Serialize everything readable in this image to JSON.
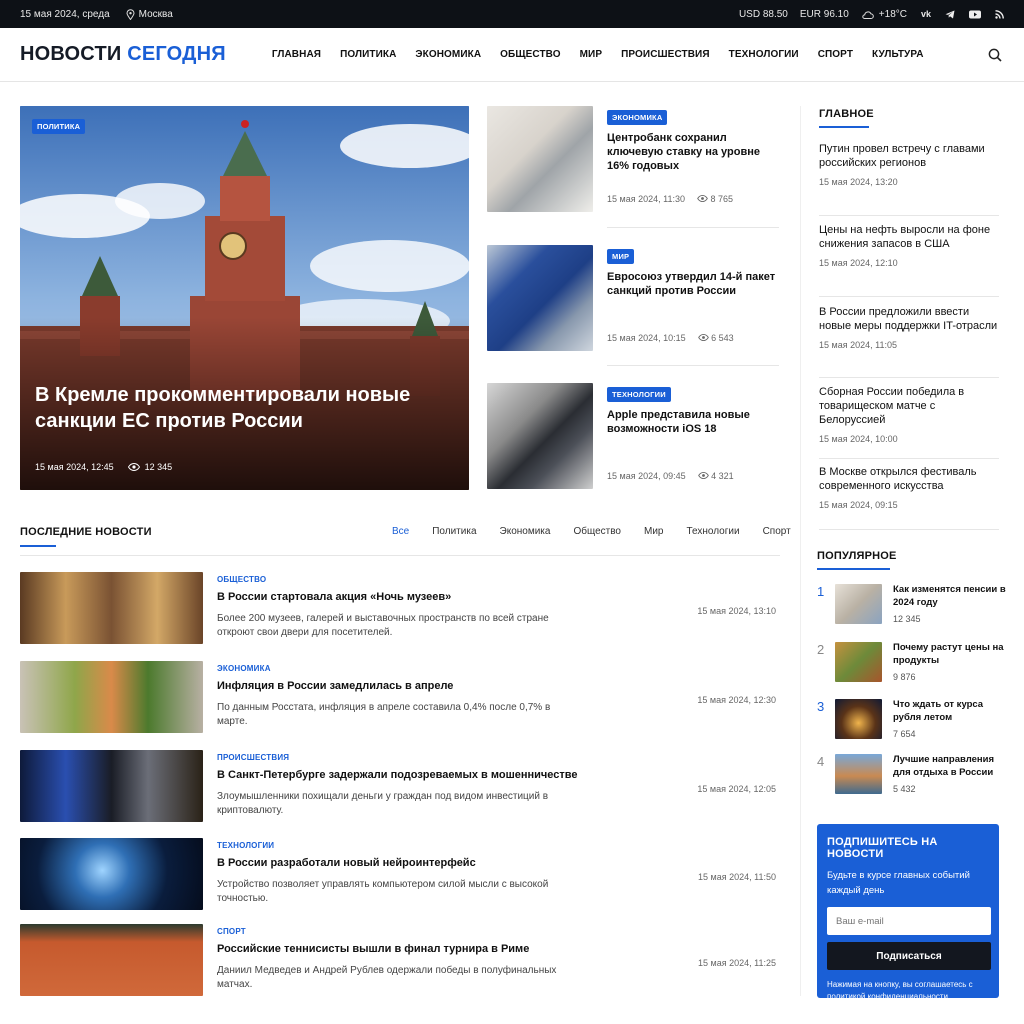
{
  "topbar": {
    "date": "15 мая 2024, среда",
    "city": "Москва",
    "usd": "USD 88.50",
    "eur": "EUR 96.10",
    "weather": "+18°C",
    "social": [
      "vk-icon",
      "telegram-icon",
      "youtube-icon",
      "rss-icon"
    ]
  },
  "header": {
    "logo_a": "НОВОСТИ",
    "logo_b": "СЕГОДНЯ",
    "nav": [
      "ГЛАВНАЯ",
      "ПОЛИТИКА",
      "ЭКОНОМИКА",
      "ОБЩЕСТВО",
      "МИР",
      "ПРОИСШЕСТВИЯ",
      "ТЕХНОЛОГИИ",
      "СПОРТ",
      "КУЛЬТУРА"
    ]
  },
  "hero": {
    "category": "ПОЛИТИКА",
    "title": "В Кремле прокомментировали новые санкции ЕС против России",
    "date": "15 мая 2024, 12:45",
    "views": "12 345"
  },
  "side_articles": [
    {
      "category": "ЭКОНОМИКА",
      "title": "Центробанк сохранил ключевую ставку на уровне 16% годовых",
      "date": "15 мая 2024, 11:30",
      "views": "8 765"
    },
    {
      "category": "МИР",
      "title": "Евросоюз утвердил 14-й пакет санкций против России",
      "date": "15 мая 2024, 10:15",
      "views": "6 543"
    },
    {
      "category": "ТЕХНОЛОГИИ",
      "title": "Apple представила новые возможности iOS 18",
      "date": "15 мая 2024, 09:45",
      "views": "4 321"
    }
  ],
  "main_block": {
    "title": "ГЛАВНОЕ",
    "items": [
      {
        "title": "Путин провел встречу с главами российских регионов",
        "date": "15 мая 2024, 13:20"
      },
      {
        "title": "Цены на нефть выросли на фоне снижения запасов в США",
        "date": "15 мая 2024, 12:10"
      },
      {
        "title": "В России предложили ввести новые меры поддержки IT-отрасли",
        "date": "15 мая 2024, 11:05"
      },
      {
        "title": "Сборная России победила в товарищеском матче с Белоруссией",
        "date": "15 мая 2024, 10:00"
      },
      {
        "title": "В Москве открылся фестиваль современного искусства",
        "date": "15 мая 2024, 09:15"
      }
    ]
  },
  "latest": {
    "title": "ПОСЛЕДНИЕ НОВОСТИ",
    "tabs": [
      "Все",
      "Политика",
      "Экономика",
      "Общество",
      "Мир",
      "Технологии",
      "Спорт"
    ],
    "items": [
      {
        "category": "ОБЩЕСТВО",
        "title": "В России стартовала акция «Ночь музеев»",
        "desc": "Более 200 музеев, галерей и выставочных пространств по всей стране откроют свои двери для посетителей.",
        "date": "15 мая 2024, 13:10"
      },
      {
        "category": "ЭКОНОМИКА",
        "title": "Инфляция в России замедлилась в апреле",
        "desc": "По данным Росстата, инфляция в апреле составила 0,4% после 0,7% в марте.",
        "date": "15 мая 2024, 12:30"
      },
      {
        "category": "ПРОИСШЕСТВИЯ",
        "title": "В Санкт-Петербурге задержали подозреваемых в мошенничестве",
        "desc": "Злоумышленники похищали деньги у граждан под видом инвестиций в криптовалюту.",
        "date": "15 мая 2024, 12:05"
      },
      {
        "category": "ТЕХНОЛОГИИ",
        "title": "В России разработали новый нейроинтерфейс",
        "desc": "Устройство позволяет управлять компьютером силой мысли с высокой точностью.",
        "date": "15 мая 2024, 11:50"
      },
      {
        "category": "СПОРТ",
        "title": "Российские теннисисты вышли в финал турнира в Риме",
        "desc": "Даниил Медведев и Андрей Рублев одержали победы в полуфинальных матчах.",
        "date": "15 мая 2024, 11:25"
      }
    ]
  },
  "popular": {
    "title": "ПОПУЛЯРНОЕ",
    "items": [
      {
        "num": "1",
        "title": "Как изменятся пенсии в 2024 году",
        "views": "12 345"
      },
      {
        "num": "2",
        "title": "Почему растут цены на продукты",
        "views": "9 876"
      },
      {
        "num": "3",
        "title": "Что ждать от курса рубля летом",
        "views": "7 654"
      },
      {
        "num": "4",
        "title": "Лучшие направления для отдыха в России",
        "views": "5 432"
      }
    ]
  },
  "subscribe": {
    "title": "ПОДПИШИТЕСЬ НА НОВОСТИ",
    "text": "Будьте в курсе главных событий каждый день",
    "placeholder": "Ваш e-mail",
    "button": "Подписаться",
    "note": "Нажимая на кнопку, вы соглашаетесь с",
    "link": "политикой конфиденциальности"
  },
  "colors": {
    "accent": "#1a5fd6",
    "topbar": "#0d1116"
  }
}
